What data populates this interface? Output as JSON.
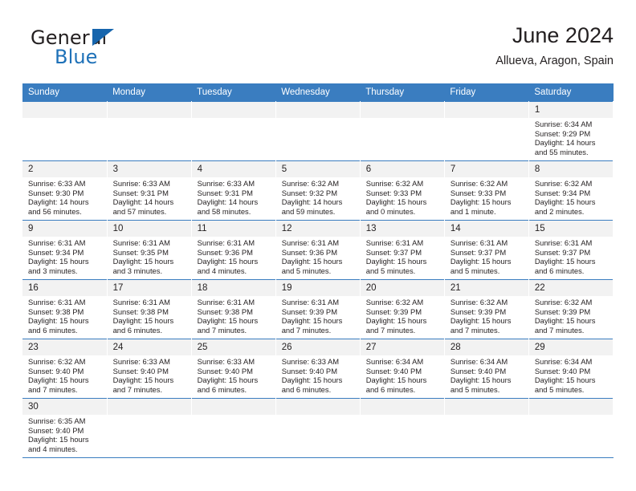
{
  "brand": {
    "name_top": "General",
    "name_bottom": "Blue",
    "accent_color": "#1665ad"
  },
  "header": {
    "title": "June 2024",
    "subtitle": "Allueva, Aragon, Spain"
  },
  "calendar": {
    "header_color": "#3a7dc0",
    "daynum_bg": "#f2f2f2",
    "weekdays": [
      "Sunday",
      "Monday",
      "Tuesday",
      "Wednesday",
      "Thursday",
      "Friday",
      "Saturday"
    ],
    "weeks": [
      [
        {
          "day": "",
          "empty": true
        },
        {
          "day": "",
          "empty": true
        },
        {
          "day": "",
          "empty": true
        },
        {
          "day": "",
          "empty": true
        },
        {
          "day": "",
          "empty": true
        },
        {
          "day": "",
          "empty": true
        },
        {
          "day": "1",
          "sunrise": "Sunrise: 6:34 AM",
          "sunset": "Sunset: 9:29 PM",
          "daylight": "Daylight: 14 hours and 55 minutes."
        }
      ],
      [
        {
          "day": "2",
          "sunrise": "Sunrise: 6:33 AM",
          "sunset": "Sunset: 9:30 PM",
          "daylight": "Daylight: 14 hours and 56 minutes."
        },
        {
          "day": "3",
          "sunrise": "Sunrise: 6:33 AM",
          "sunset": "Sunset: 9:31 PM",
          "daylight": "Daylight: 14 hours and 57 minutes."
        },
        {
          "day": "4",
          "sunrise": "Sunrise: 6:33 AM",
          "sunset": "Sunset: 9:31 PM",
          "daylight": "Daylight: 14 hours and 58 minutes."
        },
        {
          "day": "5",
          "sunrise": "Sunrise: 6:32 AM",
          "sunset": "Sunset: 9:32 PM",
          "daylight": "Daylight: 14 hours and 59 minutes."
        },
        {
          "day": "6",
          "sunrise": "Sunrise: 6:32 AM",
          "sunset": "Sunset: 9:33 PM",
          "daylight": "Daylight: 15 hours and 0 minutes."
        },
        {
          "day": "7",
          "sunrise": "Sunrise: 6:32 AM",
          "sunset": "Sunset: 9:33 PM",
          "daylight": "Daylight: 15 hours and 1 minute."
        },
        {
          "day": "8",
          "sunrise": "Sunrise: 6:32 AM",
          "sunset": "Sunset: 9:34 PM",
          "daylight": "Daylight: 15 hours and 2 minutes."
        }
      ],
      [
        {
          "day": "9",
          "sunrise": "Sunrise: 6:31 AM",
          "sunset": "Sunset: 9:34 PM",
          "daylight": "Daylight: 15 hours and 3 minutes."
        },
        {
          "day": "10",
          "sunrise": "Sunrise: 6:31 AM",
          "sunset": "Sunset: 9:35 PM",
          "daylight": "Daylight: 15 hours and 3 minutes."
        },
        {
          "day": "11",
          "sunrise": "Sunrise: 6:31 AM",
          "sunset": "Sunset: 9:36 PM",
          "daylight": "Daylight: 15 hours and 4 minutes."
        },
        {
          "day": "12",
          "sunrise": "Sunrise: 6:31 AM",
          "sunset": "Sunset: 9:36 PM",
          "daylight": "Daylight: 15 hours and 5 minutes."
        },
        {
          "day": "13",
          "sunrise": "Sunrise: 6:31 AM",
          "sunset": "Sunset: 9:37 PM",
          "daylight": "Daylight: 15 hours and 5 minutes."
        },
        {
          "day": "14",
          "sunrise": "Sunrise: 6:31 AM",
          "sunset": "Sunset: 9:37 PM",
          "daylight": "Daylight: 15 hours and 5 minutes."
        },
        {
          "day": "15",
          "sunrise": "Sunrise: 6:31 AM",
          "sunset": "Sunset: 9:37 PM",
          "daylight": "Daylight: 15 hours and 6 minutes."
        }
      ],
      [
        {
          "day": "16",
          "sunrise": "Sunrise: 6:31 AM",
          "sunset": "Sunset: 9:38 PM",
          "daylight": "Daylight: 15 hours and 6 minutes."
        },
        {
          "day": "17",
          "sunrise": "Sunrise: 6:31 AM",
          "sunset": "Sunset: 9:38 PM",
          "daylight": "Daylight: 15 hours and 6 minutes."
        },
        {
          "day": "18",
          "sunrise": "Sunrise: 6:31 AM",
          "sunset": "Sunset: 9:38 PM",
          "daylight": "Daylight: 15 hours and 7 minutes."
        },
        {
          "day": "19",
          "sunrise": "Sunrise: 6:31 AM",
          "sunset": "Sunset: 9:39 PM",
          "daylight": "Daylight: 15 hours and 7 minutes."
        },
        {
          "day": "20",
          "sunrise": "Sunrise: 6:32 AM",
          "sunset": "Sunset: 9:39 PM",
          "daylight": "Daylight: 15 hours and 7 minutes."
        },
        {
          "day": "21",
          "sunrise": "Sunrise: 6:32 AM",
          "sunset": "Sunset: 9:39 PM",
          "daylight": "Daylight: 15 hours and 7 minutes."
        },
        {
          "day": "22",
          "sunrise": "Sunrise: 6:32 AM",
          "sunset": "Sunset: 9:39 PM",
          "daylight": "Daylight: 15 hours and 7 minutes."
        }
      ],
      [
        {
          "day": "23",
          "sunrise": "Sunrise: 6:32 AM",
          "sunset": "Sunset: 9:40 PM",
          "daylight": "Daylight: 15 hours and 7 minutes."
        },
        {
          "day": "24",
          "sunrise": "Sunrise: 6:33 AM",
          "sunset": "Sunset: 9:40 PM",
          "daylight": "Daylight: 15 hours and 7 minutes."
        },
        {
          "day": "25",
          "sunrise": "Sunrise: 6:33 AM",
          "sunset": "Sunset: 9:40 PM",
          "daylight": "Daylight: 15 hours and 6 minutes."
        },
        {
          "day": "26",
          "sunrise": "Sunrise: 6:33 AM",
          "sunset": "Sunset: 9:40 PM",
          "daylight": "Daylight: 15 hours and 6 minutes."
        },
        {
          "day": "27",
          "sunrise": "Sunrise: 6:34 AM",
          "sunset": "Sunset: 9:40 PM",
          "daylight": "Daylight: 15 hours and 6 minutes."
        },
        {
          "day": "28",
          "sunrise": "Sunrise: 6:34 AM",
          "sunset": "Sunset: 9:40 PM",
          "daylight": "Daylight: 15 hours and 5 minutes."
        },
        {
          "day": "29",
          "sunrise": "Sunrise: 6:34 AM",
          "sunset": "Sunset: 9:40 PM",
          "daylight": "Daylight: 15 hours and 5 minutes."
        }
      ],
      [
        {
          "day": "30",
          "sunrise": "Sunrise: 6:35 AM",
          "sunset": "Sunset: 9:40 PM",
          "daylight": "Daylight: 15 hours and 4 minutes."
        },
        {
          "day": "",
          "empty": true
        },
        {
          "day": "",
          "empty": true
        },
        {
          "day": "",
          "empty": true
        },
        {
          "day": "",
          "empty": true
        },
        {
          "day": "",
          "empty": true
        },
        {
          "day": "",
          "empty": true
        }
      ]
    ]
  }
}
